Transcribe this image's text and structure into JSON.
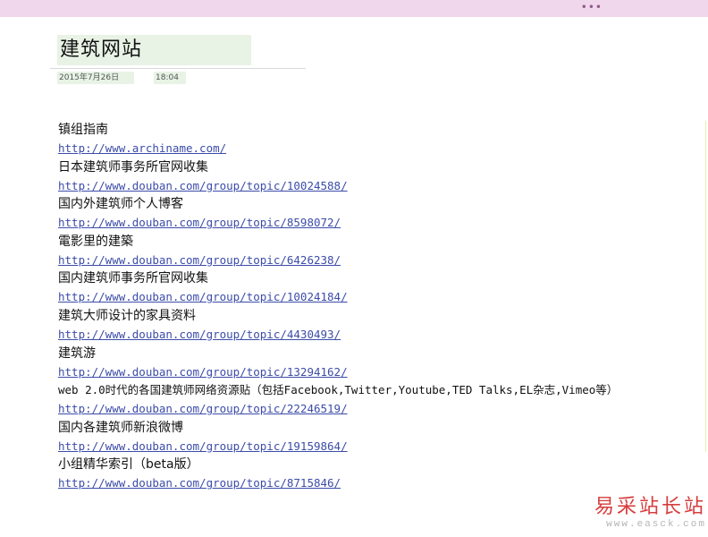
{
  "top_bar": {
    "more_icon": "more-dots-icon",
    "more_glyph": "•••"
  },
  "page": {
    "title": "建筑网站",
    "date": "2015年7月26日",
    "time": "18:04"
  },
  "items": [
    {
      "label": "镇组指南",
      "url": "http://www.archiname.com/"
    },
    {
      "label": "日本建筑师事务所官网收集",
      "url": "http://www.douban.com/group/topic/10024588/"
    },
    {
      "label": "国内外建筑师个人博客",
      "url": "http://www.douban.com/group/topic/8598072/"
    },
    {
      "label": "電影里的建築",
      "url": "http://www.douban.com/group/topic/6426238/"
    },
    {
      "label": "国内建筑师事务所官网收集",
      "url": "http://www.douban.com/group/topic/10024184/"
    },
    {
      "label": "建筑大师设计的家具资料",
      "url": "http://www.douban.com/group/topic/4430493/"
    },
    {
      "label": "建筑游",
      "url": "http://www.douban.com/group/topic/13294162/"
    },
    {
      "label": "web 2.0时代的各国建筑师网络资源贴（包括Facebook,Twitter,Youtube,TED Talks,EL杂志,Vimeo等）",
      "url": "http://www.douban.com/group/topic/22246519/"
    },
    {
      "label": "国内各建筑师新浪微博",
      "url": "http://www.douban.com/group/topic/19159864/"
    },
    {
      "label": "小组精华索引（beta版）",
      "url": "http://www.douban.com/group/topic/8715846/"
    }
  ],
  "watermark": {
    "title": "易采站长站",
    "url": "www.easck.com"
  }
}
